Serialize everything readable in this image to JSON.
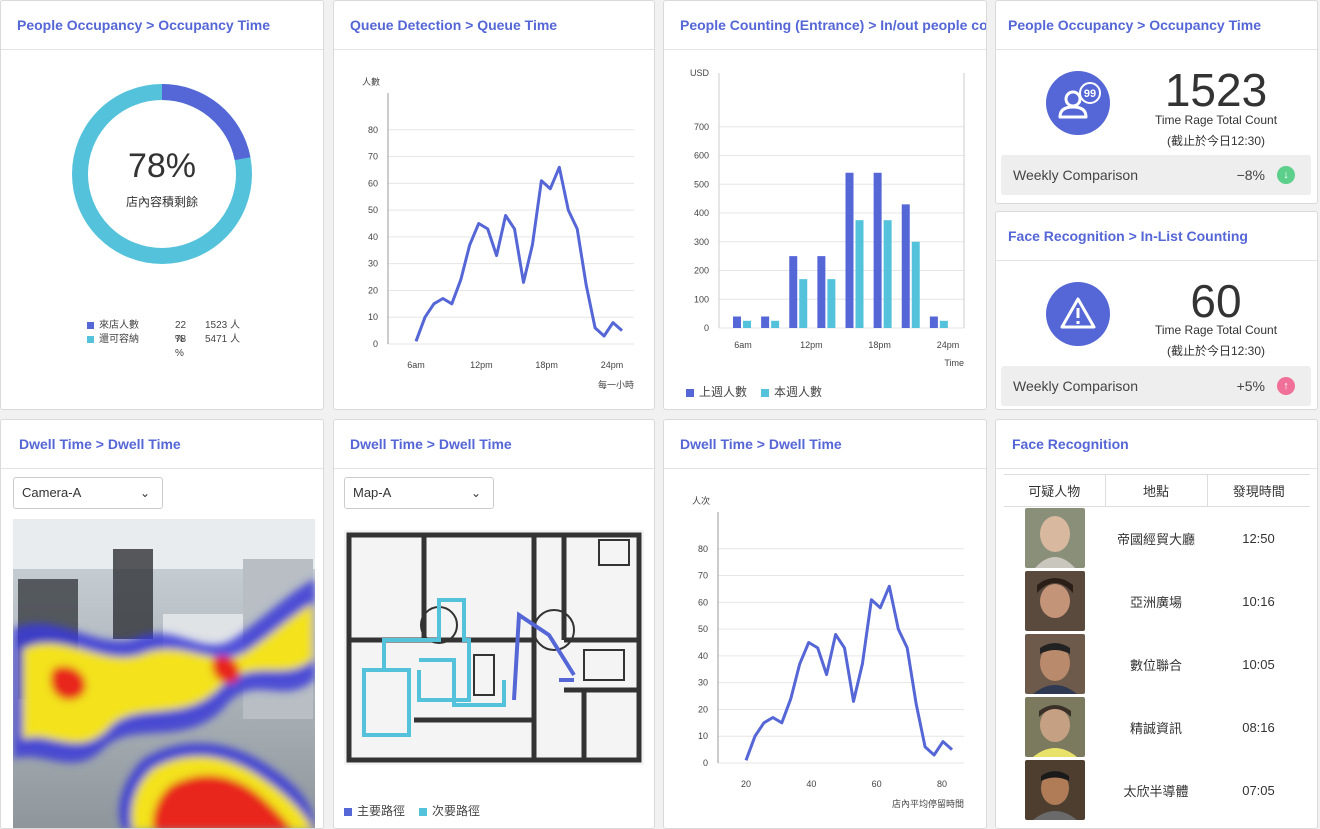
{
  "cards": {
    "occupancy": {
      "title": "People Occupancy > Occupancy Time",
      "percent": "78%",
      "center_label": "店內容積剩餘",
      "legend": [
        {
          "label": "來店人數",
          "pct": "22 %",
          "value": "1523 人",
          "color": "#5566d6"
        },
        {
          "label": "還可容納",
          "pct": "78 %",
          "value": "5471 人",
          "color": "#55c2dc"
        }
      ],
      "donut_fraction": 0.22
    },
    "queue": {
      "title": "Queue Detection > Queue Time",
      "ylabel": "人數",
      "xlabel": "每一小時"
    },
    "counting": {
      "title": "People Counting (Entrance) >  In/out people counting",
      "ylabel": "USD",
      "xlabel": "Time",
      "legend": [
        {
          "label": "上週人數",
          "color": "#5566d6"
        },
        {
          "label": "本週人數",
          "color": "#55c2dc"
        }
      ]
    },
    "occ_total": {
      "title": "People Occupancy > Occupancy Time",
      "number": "1523",
      "label1": "Time Rage Total Count",
      "label2": "(截止於今日12:30)",
      "cmp_label": "Weekly Comparison",
      "cmp_value": "−8%",
      "cmp_color": "#5ccf8a",
      "badge": "99"
    },
    "face_count": {
      "title": "Face Recognition > In-List Counting",
      "number": "60",
      "label1": "Time Rage Total Count",
      "label2": "(截止於今日12:30)",
      "cmp_label": "Weekly Comparison",
      "cmp_value": "+5%",
      "cmp_color": "#f0709a"
    },
    "dwell1": {
      "title": "Dwell Time > Dwell Time",
      "select": "Camera-A"
    },
    "dwell2": {
      "title": "Dwell Time > Dwell Time",
      "select": "Map-A",
      "legend": [
        {
          "label": "主要路徑",
          "color": "#5566d6"
        },
        {
          "label": "次要路徑",
          "color": "#55c2dc"
        }
      ]
    },
    "dwell3": {
      "title": "Dwell Time > Dwell Time",
      "ylabel": "人次",
      "xlabel": "店內平均停留時間"
    },
    "face_rec": {
      "title": "Face Recognition",
      "headers": [
        "可疑人物",
        "地點",
        "發現時間"
      ],
      "rows": [
        {
          "place": "帝國經貿大廳",
          "time": "12:50"
        },
        {
          "place": "亞洲廣場",
          "time": "10:16"
        },
        {
          "place": "數位聯合",
          "time": "10:05"
        },
        {
          "place": "精誠資訊",
          "time": "08:16"
        },
        {
          "place": "太欣半導體",
          "time": "07:05"
        }
      ]
    }
  },
  "chart_data": [
    {
      "type": "line",
      "title": "Queue Detection > Queue Time",
      "ylabel": "人數",
      "xlabel": "每一小時",
      "ylim": [
        0,
        90
      ],
      "yticks": [
        0,
        10,
        20,
        30,
        40,
        50,
        60,
        70,
        80
      ],
      "xticks": [
        "6am",
        "12pm",
        "18pm",
        "24pm"
      ],
      "values": [
        1,
        10,
        15,
        17,
        15,
        24,
        37,
        45,
        43,
        33,
        48,
        43,
        23,
        37,
        61,
        58,
        66,
        50,
        43,
        22,
        6,
        3,
        8,
        5
      ],
      "color": "#5566d6"
    },
    {
      "type": "bar",
      "title": "People Counting (Entrance) >  In/out people counting",
      "ylabel": "USD",
      "xlabel": "Time",
      "ylim": [
        0,
        800
      ],
      "yticks": [
        0,
        100,
        200,
        300,
        400,
        500,
        600,
        700
      ],
      "xticks": [
        "6am",
        "12pm",
        "18pm",
        "24pm"
      ],
      "series": [
        {
          "name": "上週人數",
          "values": [
            40,
            40,
            250,
            250,
            540,
            540,
            430,
            40
          ],
          "color": "#5566d6"
        },
        {
          "name": "本週人數",
          "values": [
            25,
            25,
            170,
            170,
            375,
            375,
            300,
            25
          ],
          "color": "#55c2dc"
        }
      ]
    },
    {
      "type": "line",
      "title": "Dwell Time > Dwell Time",
      "ylabel": "人次",
      "xlabel": "店內平均停留時間",
      "ylim": [
        0,
        90
      ],
      "yticks": [
        0,
        10,
        20,
        30,
        40,
        50,
        60,
        70,
        80
      ],
      "xticks": [
        "20",
        "40",
        "60",
        "80"
      ],
      "values": [
        1,
        10,
        15,
        17,
        15,
        24,
        37,
        45,
        43,
        33,
        48,
        43,
        23,
        37,
        61,
        58,
        66,
        50,
        43,
        22,
        6,
        3,
        8,
        5
      ],
      "color": "#5566d6"
    }
  ]
}
